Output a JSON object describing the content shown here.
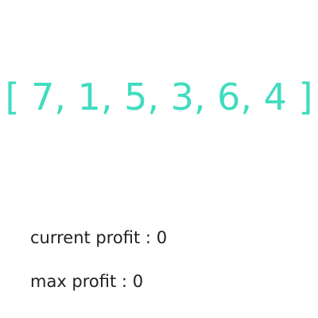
{
  "array": {
    "text": "[ 7, 1, 5, 3, 6, 4 ]",
    "color": "#40dcbf"
  },
  "stats": {
    "current_profit": {
      "label": "current profit",
      "separator": " : ",
      "value": "0"
    },
    "max_profit": {
      "label": "max profit",
      "separator": " : ",
      "value": "0"
    }
  }
}
